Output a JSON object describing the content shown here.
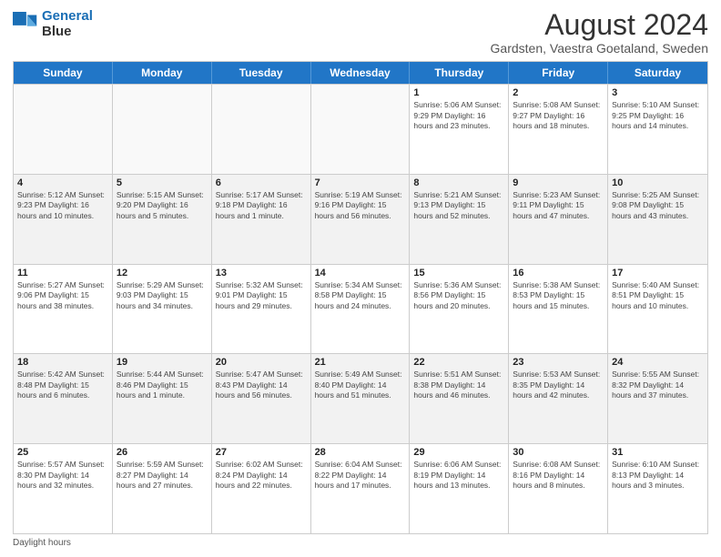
{
  "header": {
    "logo_line1": "General",
    "logo_line2": "Blue",
    "main_title": "August 2024",
    "subtitle": "Gardsten, Vaestra Goetaland, Sweden"
  },
  "days_of_week": [
    "Sunday",
    "Monday",
    "Tuesday",
    "Wednesday",
    "Thursday",
    "Friday",
    "Saturday"
  ],
  "footer_text": "Daylight hours",
  "rows": [
    [
      {
        "day": "",
        "info": "",
        "empty": true
      },
      {
        "day": "",
        "info": "",
        "empty": true
      },
      {
        "day": "",
        "info": "",
        "empty": true
      },
      {
        "day": "",
        "info": "",
        "empty": true
      },
      {
        "day": "1",
        "info": "Sunrise: 5:06 AM\nSunset: 9:29 PM\nDaylight: 16 hours\nand 23 minutes."
      },
      {
        "day": "2",
        "info": "Sunrise: 5:08 AM\nSunset: 9:27 PM\nDaylight: 16 hours\nand 18 minutes."
      },
      {
        "day": "3",
        "info": "Sunrise: 5:10 AM\nSunset: 9:25 PM\nDaylight: 16 hours\nand 14 minutes."
      }
    ],
    [
      {
        "day": "4",
        "info": "Sunrise: 5:12 AM\nSunset: 9:23 PM\nDaylight: 16 hours\nand 10 minutes.",
        "alt": true
      },
      {
        "day": "5",
        "info": "Sunrise: 5:15 AM\nSunset: 9:20 PM\nDaylight: 16 hours\nand 5 minutes.",
        "alt": true
      },
      {
        "day": "6",
        "info": "Sunrise: 5:17 AM\nSunset: 9:18 PM\nDaylight: 16 hours\nand 1 minute.",
        "alt": true
      },
      {
        "day": "7",
        "info": "Sunrise: 5:19 AM\nSunset: 9:16 PM\nDaylight: 15 hours\nand 56 minutes.",
        "alt": true
      },
      {
        "day": "8",
        "info": "Sunrise: 5:21 AM\nSunset: 9:13 PM\nDaylight: 15 hours\nand 52 minutes.",
        "alt": true
      },
      {
        "day": "9",
        "info": "Sunrise: 5:23 AM\nSunset: 9:11 PM\nDaylight: 15 hours\nand 47 minutes.",
        "alt": true
      },
      {
        "day": "10",
        "info": "Sunrise: 5:25 AM\nSunset: 9:08 PM\nDaylight: 15 hours\nand 43 minutes.",
        "alt": true
      }
    ],
    [
      {
        "day": "11",
        "info": "Sunrise: 5:27 AM\nSunset: 9:06 PM\nDaylight: 15 hours\nand 38 minutes."
      },
      {
        "day": "12",
        "info": "Sunrise: 5:29 AM\nSunset: 9:03 PM\nDaylight: 15 hours\nand 34 minutes."
      },
      {
        "day": "13",
        "info": "Sunrise: 5:32 AM\nSunset: 9:01 PM\nDaylight: 15 hours\nand 29 minutes."
      },
      {
        "day": "14",
        "info": "Sunrise: 5:34 AM\nSunset: 8:58 PM\nDaylight: 15 hours\nand 24 minutes."
      },
      {
        "day": "15",
        "info": "Sunrise: 5:36 AM\nSunset: 8:56 PM\nDaylight: 15 hours\nand 20 minutes."
      },
      {
        "day": "16",
        "info": "Sunrise: 5:38 AM\nSunset: 8:53 PM\nDaylight: 15 hours\nand 15 minutes."
      },
      {
        "day": "17",
        "info": "Sunrise: 5:40 AM\nSunset: 8:51 PM\nDaylight: 15 hours\nand 10 minutes."
      }
    ],
    [
      {
        "day": "18",
        "info": "Sunrise: 5:42 AM\nSunset: 8:48 PM\nDaylight: 15 hours\nand 6 minutes.",
        "alt": true
      },
      {
        "day": "19",
        "info": "Sunrise: 5:44 AM\nSunset: 8:46 PM\nDaylight: 15 hours\nand 1 minute.",
        "alt": true
      },
      {
        "day": "20",
        "info": "Sunrise: 5:47 AM\nSunset: 8:43 PM\nDaylight: 14 hours\nand 56 minutes.",
        "alt": true
      },
      {
        "day": "21",
        "info": "Sunrise: 5:49 AM\nSunset: 8:40 PM\nDaylight: 14 hours\nand 51 minutes.",
        "alt": true
      },
      {
        "day": "22",
        "info": "Sunrise: 5:51 AM\nSunset: 8:38 PM\nDaylight: 14 hours\nand 46 minutes.",
        "alt": true
      },
      {
        "day": "23",
        "info": "Sunrise: 5:53 AM\nSunset: 8:35 PM\nDaylight: 14 hours\nand 42 minutes.",
        "alt": true
      },
      {
        "day": "24",
        "info": "Sunrise: 5:55 AM\nSunset: 8:32 PM\nDaylight: 14 hours\nand 37 minutes.",
        "alt": true
      }
    ],
    [
      {
        "day": "25",
        "info": "Sunrise: 5:57 AM\nSunset: 8:30 PM\nDaylight: 14 hours\nand 32 minutes."
      },
      {
        "day": "26",
        "info": "Sunrise: 5:59 AM\nSunset: 8:27 PM\nDaylight: 14 hours\nand 27 minutes."
      },
      {
        "day": "27",
        "info": "Sunrise: 6:02 AM\nSunset: 8:24 PM\nDaylight: 14 hours\nand 22 minutes."
      },
      {
        "day": "28",
        "info": "Sunrise: 6:04 AM\nSunset: 8:22 PM\nDaylight: 14 hours\nand 17 minutes."
      },
      {
        "day": "29",
        "info": "Sunrise: 6:06 AM\nSunset: 8:19 PM\nDaylight: 14 hours\nand 13 minutes."
      },
      {
        "day": "30",
        "info": "Sunrise: 6:08 AM\nSunset: 8:16 PM\nDaylight: 14 hours\nand 8 minutes."
      },
      {
        "day": "31",
        "info": "Sunrise: 6:10 AM\nSunset: 8:13 PM\nDaylight: 14 hours\nand 3 minutes."
      }
    ]
  ]
}
